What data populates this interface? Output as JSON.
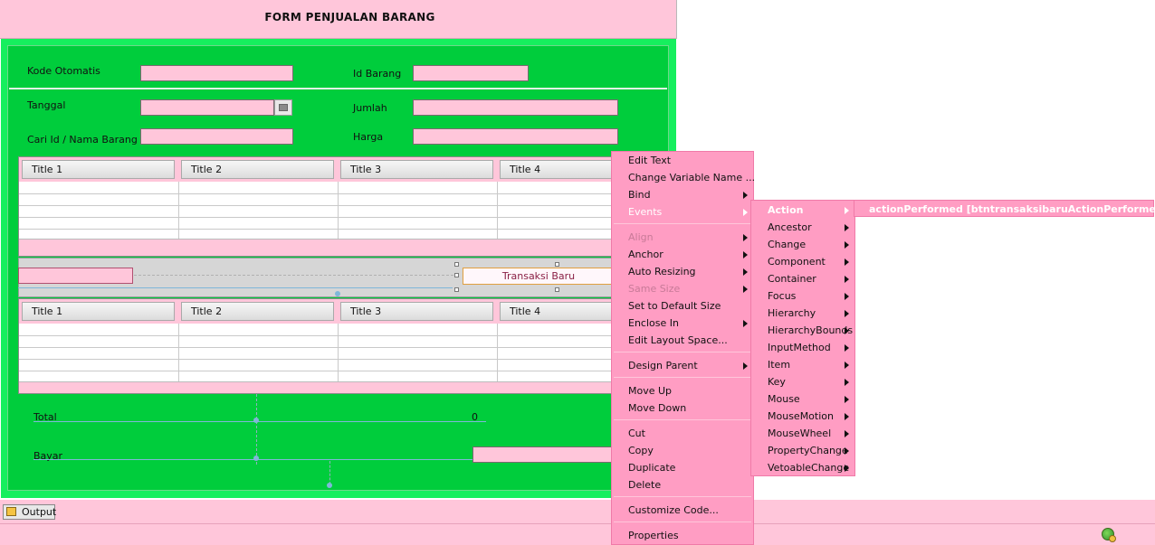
{
  "form": {
    "title": "FORM PENJUALAN BARANG",
    "labels": {
      "kode": "Kode Otomatis",
      "id_barang": "Id Barang",
      "tanggal": "Tanggal",
      "jumlah": "Jumlah",
      "cari": "Cari Id / Nama Barang",
      "harga": "Harga",
      "total": "Total",
      "total_value": "0",
      "bayar": "Bayar"
    },
    "button_transaksi": "Transaksi Baru"
  },
  "table_top": {
    "headers": [
      "Title 1",
      "Title 2",
      "Title 3",
      "Title 4"
    ]
  },
  "table_bottom": {
    "headers": [
      "Title 1",
      "Title 2",
      "Title 3",
      "Title 4"
    ]
  },
  "context_menu": {
    "items": [
      {
        "label": "Edit Text",
        "arrow": false,
        "disabled": false
      },
      {
        "label": "Change Variable Name ...",
        "arrow": false,
        "disabled": false
      },
      {
        "label": "Bind",
        "arrow": true,
        "disabled": false
      },
      {
        "label": "Events",
        "arrow": true,
        "disabled": false
      },
      {
        "label": "Align",
        "arrow": true,
        "disabled": true
      },
      {
        "label": "Anchor",
        "arrow": true,
        "disabled": false
      },
      {
        "label": "Auto Resizing",
        "arrow": true,
        "disabled": false
      },
      {
        "label": "Same Size",
        "arrow": true,
        "disabled": true
      },
      {
        "label": "Set to Default Size",
        "arrow": false,
        "disabled": false
      },
      {
        "label": "Enclose In",
        "arrow": true,
        "disabled": false
      },
      {
        "label": "Edit Layout Space...",
        "arrow": false,
        "disabled": false
      },
      {
        "label": "Design Parent",
        "arrow": true,
        "disabled": false
      },
      {
        "label": "Move Up",
        "arrow": false,
        "disabled": false
      },
      {
        "label": "Move Down",
        "arrow": false,
        "disabled": false
      },
      {
        "label": "Cut",
        "arrow": false,
        "disabled": false
      },
      {
        "label": "Copy",
        "arrow": false,
        "disabled": false
      },
      {
        "label": "Duplicate",
        "arrow": false,
        "disabled": false
      },
      {
        "label": "Delete",
        "arrow": false,
        "disabled": false
      },
      {
        "label": "Customize Code...",
        "arrow": false,
        "disabled": false
      },
      {
        "label": "Properties",
        "arrow": false,
        "disabled": false
      }
    ]
  },
  "events_menu": {
    "items": [
      "Action",
      "Ancestor",
      "Change",
      "Component",
      "Container",
      "Focus",
      "Hierarchy",
      "HierarchyBounds",
      "InputMethod",
      "Item",
      "Key",
      "Mouse",
      "MouseMotion",
      "MouseWheel",
      "PropertyChange",
      "VetoableChange"
    ]
  },
  "action_menu": {
    "item": "actionPerformed [btntransaksibaruActionPerformed]"
  },
  "output_tab": {
    "label": "Output"
  }
}
